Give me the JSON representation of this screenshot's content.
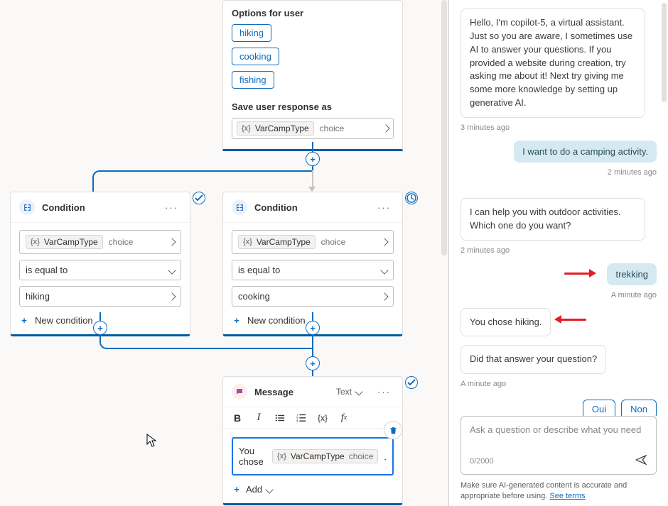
{
  "canvas": {
    "options_card": {
      "title": "Options for user",
      "chips": [
        "hiking",
        "cooking",
        "fishing"
      ],
      "save_label": "Save user response as",
      "variable": {
        "x": "{x}",
        "name": "VarCampType",
        "kind": "choice"
      }
    },
    "condition_a": {
      "title": "Condition",
      "variable": {
        "name": "VarCampType",
        "kind": "choice"
      },
      "operator": "is equal to",
      "value": "hiking",
      "new_cond": "New condition",
      "status": "check"
    },
    "condition_b": {
      "title": "Condition",
      "variable": {
        "name": "VarCampType",
        "kind": "choice"
      },
      "operator": "is equal to",
      "value": "cooking",
      "new_cond": "New condition",
      "status": "history"
    },
    "message_card": {
      "title": "Message",
      "type_label": "Text",
      "prefix": "You chose",
      "variable": {
        "name": "VarCampType",
        "kind": "choice"
      },
      "add_label": "Add",
      "status": "check"
    }
  },
  "chat": {
    "m1": "Hello, I'm copilot-5, a virtual assistant. Just so you are aware, I sometimes use AI to answer your questions. If you provided a website during creation, try asking me about it! Next try giving me some more knowledge by setting up generative AI.",
    "ts1": "3 minutes ago",
    "u1": "I want to do a camping activity.",
    "ts_u1": "2 minutes ago",
    "m2": "I can help you with outdoor activities. Which one do you want?",
    "ts2": "2 minutes ago",
    "u2": "trekking",
    "ts_u2": "A minute ago",
    "m3": "You chose hiking.",
    "m4": "Did that answer your question?",
    "ts3": "A minute ago",
    "quick": [
      "Oui",
      "Non"
    ],
    "ask_placeholder": "Ask a question or describe what you need",
    "counter": "0/2000",
    "disclaimer_a": "Make sure AI-generated content is accurate and appropriate before using. ",
    "disclaimer_link": "See terms"
  }
}
